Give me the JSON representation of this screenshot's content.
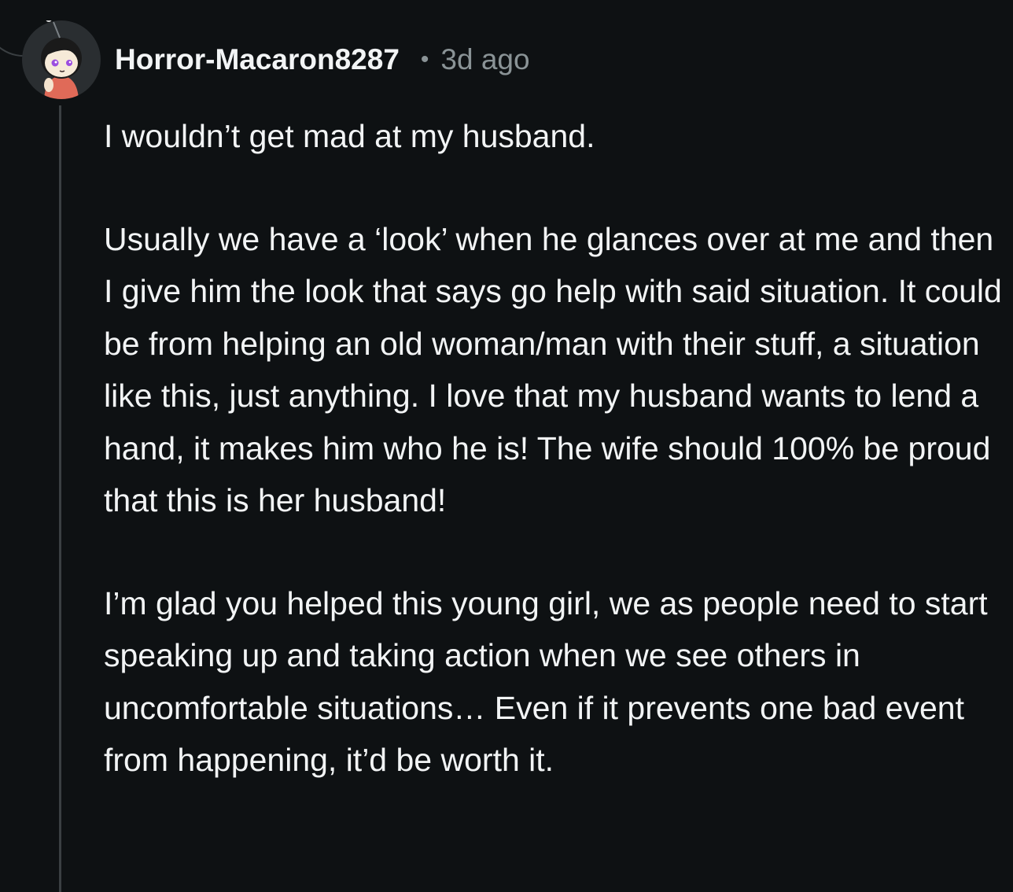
{
  "comment": {
    "author": "Horror-Macaron8287",
    "separator": "•",
    "timestamp": "3d ago",
    "avatar_icon": "snoo-avatar-icon",
    "paragraphs": [
      "I wouldn’t get mad at my husband.",
      "Usually we have a ‘look’ when he glances over at me and then I give him the look that says go help with said situation. It could be from helping an old woman/man with their stuff, a situation like this, just anything. I love that my husband wants to lend a hand, it makes him who he is! The wife should 100% be proud that this is her husband!",
      "I’m glad you helped this young girl, we as people need to start speaking up and taking action when we see others in uncomfortable situations… Even if it prevents one bad event from happening, it’d be worth it."
    ]
  },
  "colors": {
    "background": "#0e1113",
    "text": "#f2f4f5",
    "meta": "#8a9396",
    "thread_line": "#3a3f42"
  }
}
